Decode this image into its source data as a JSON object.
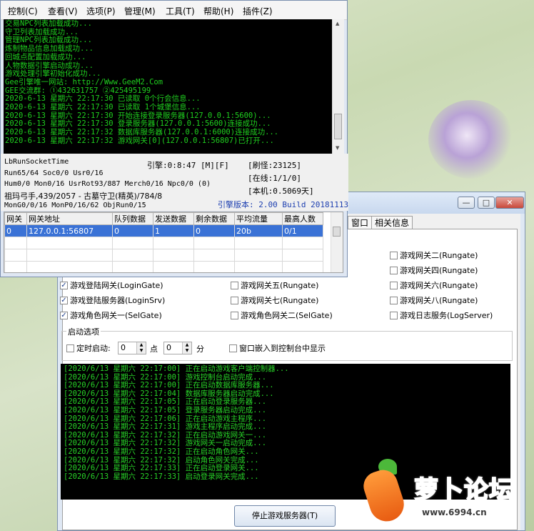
{
  "engine": {
    "menu": [
      "控制(C)",
      "查看(V)",
      "选项(P)",
      "管理(M)",
      "工具(T)",
      "帮助(H)",
      "插件(Z)"
    ],
    "log": [
      "交易NPC列表加载成功...",
      "守卫列表加载成功...",
      "管理NPC列表加载成功...",
      "炼制物品信息加载成功...",
      "回城点配置加载成功...",
      "人物数据引擎启动成功...",
      "游戏处理引擎初始化成功...",
      "Gee引擎唯一网站: http://Www.GeeM2.Com",
      "GEE交流群: ①432631757   ②425495199",
      "2020-6-13 星期六 22:17:30 已读取 0个行会信息...",
      "2020-6-13 星期六 22:17:30 已读取 1个城堡信息...",
      "2020-6-13 星期六 22:17:30 开始连接登录服务器(127.0.0.1:5600)...",
      "2020-6-13 星期六 22:17:30 登录服务器(127.0.0.1:5600)连接成功...",
      "2020-6-13 星期六 22:17:32 数据库服务器(127.0.0.1:6000)连接成功...",
      "2020-6-13 星期六 22:17:32 游戏网关[0](127.0.0.1:56807)已打开..."
    ],
    "status": {
      "socket": "LbRunSocketTime",
      "engine_time": "引擎:0:8:47 [M][F]",
      "refresh": "[刷怪:23125]",
      "run": "Run65/64 Soc0/0 Usr0/16",
      "online": "[在线:1/1/0]",
      "hum": "Hum0/0 Mon0/16 UsrRot93/887 Merch0/16 Npc0/0 (0)",
      "local": "[本机:0.5069天]",
      "map": "祖玛弓手,439/2057 - 古墓守卫(精英)/784/8",
      "mon": "MonG0/0/16 MonP0/16/62 ObjRun0/15",
      "version": "引擎版本: 2.00 Build 20181113"
    },
    "table": {
      "headers": [
        "网关",
        "网关地址",
        "队列数据",
        "发送数据",
        "剩余数据",
        "平均流量",
        "最高人数"
      ],
      "rows": [
        [
          "0",
          "127.0.0.1:56807",
          "0",
          "1",
          "0",
          "20b",
          "0/1"
        ]
      ]
    }
  },
  "controller": {
    "tabs": [
      "窗口",
      "相关信息"
    ],
    "checkboxes": {
      "gate2": "游戏网关二(Rungate)",
      "gate4": "游戏网关四(Rungate)",
      "logingate": "游戏登陆网关(LoginGate)",
      "gate5": "游戏网关五(Rungate)",
      "gate6": "游戏网关六(Rungate)",
      "loginsrv": "游戏登陆服务器(LoginSrv)",
      "gate7": "游戏网关七(Rungate)",
      "gate8": "游戏网关八(Rungate)",
      "selgate1": "游戏角色网关一(SelGate)",
      "selgate2": "游戏角色网关二(SelGate)",
      "logserver": "游戏日志服务(LogServer)"
    },
    "startup": {
      "title": "启动选项",
      "timed": "定时启动:",
      "hour": "0",
      "hour_unit": "点",
      "minute": "0",
      "minute_unit": "分",
      "embed": "窗口嵌入到控制台中显示"
    },
    "log": [
      "[2020/6/13 星期六 22:17:00] 正在启动游戏客户端控制器...",
      "[2020/6/13 星期六 22:17:00] 游戏控制台启动完成...",
      "[2020/6/13 星期六 22:17:00] 正在启动数据库服务器...",
      "[2020/6/13 星期六 22:17:04] 数据库服务器启动完成...",
      "[2020/6/13 星期六 22:17:05] 正在启动登录服务器...",
      "[2020/6/13 星期六 22:17:05] 登录服务器启动完成...",
      "[2020/6/13 星期六 22:17:06] 正在启动游戏主程序...",
      "[2020/6/13 星期六 22:17:31] 游戏主程序启动完成...",
      "[2020/6/13 星期六 22:17:32] 正在启动游戏网关一...",
      "[2020/6/13 星期六 22:17:32] 游戏网关一启动完成...",
      "[2020/6/13 星期六 22:17:32] 正在启动角色网关...",
      "[2020/6/13 星期六 22:17:32] 启动角色网关完成...",
      "[2020/6/13 星期六 22:17:33] 正在启动登录网关...",
      "[2020/6/13 星期六 22:17:33] 启动登录网关完成..."
    ],
    "stop_button": "停止游戏服务器(T)"
  },
  "watermark": {
    "brand": "萝卜论坛",
    "site": "www.6994.cn"
  },
  "colors": {
    "log_text": "#1fd01f",
    "log_bg": "#000000",
    "selected_row": "#3a72d6",
    "brand_orange": "#ff7a1a"
  }
}
